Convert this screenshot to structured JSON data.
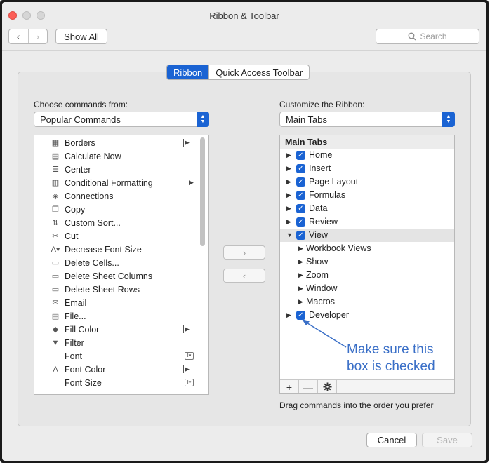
{
  "window": {
    "title": "Ribbon & Toolbar"
  },
  "toolbar": {
    "back_glyph": "‹",
    "forward_glyph": "›",
    "show_all_label": "Show All",
    "search_placeholder": "Search"
  },
  "tabs": [
    {
      "label": "Ribbon",
      "active": true
    },
    {
      "label": "Quick Access Toolbar",
      "active": false
    }
  ],
  "left": {
    "choose_label": "Choose commands from:",
    "selected": "Popular Commands",
    "commands": [
      {
        "label": "Borders",
        "icon": "borders-icon",
        "glyph": "▦",
        "arrow": "bar"
      },
      {
        "label": "Calculate Now",
        "icon": "calculate-icon",
        "glyph": "▤",
        "arrow": ""
      },
      {
        "label": "Center",
        "icon": "align-center-icon",
        "glyph": "☰",
        "arrow": ""
      },
      {
        "label": "Conditional Formatting",
        "icon": "conditional-formatting-icon",
        "glyph": "▥",
        "arrow": "plain"
      },
      {
        "label": "Connections",
        "icon": "connections-icon",
        "glyph": "◈",
        "arrow": ""
      },
      {
        "label": "Copy",
        "icon": "copy-icon",
        "glyph": "❐",
        "arrow": ""
      },
      {
        "label": "Custom Sort...",
        "icon": "sort-icon",
        "glyph": "⇅",
        "arrow": ""
      },
      {
        "label": "Cut",
        "icon": "scissors-icon",
        "glyph": "✂",
        "arrow": ""
      },
      {
        "label": "Decrease Font Size",
        "icon": "decrease-font-icon",
        "glyph": "A▾",
        "arrow": ""
      },
      {
        "label": "Delete Cells...",
        "icon": "delete-cells-icon",
        "glyph": "▭",
        "arrow": ""
      },
      {
        "label": "Delete Sheet Columns",
        "icon": "delete-columns-icon",
        "glyph": "▭",
        "arrow": ""
      },
      {
        "label": "Delete Sheet Rows",
        "icon": "delete-rows-icon",
        "glyph": "▭",
        "arrow": ""
      },
      {
        "label": "Email",
        "icon": "email-icon",
        "glyph": "✉",
        "arrow": ""
      },
      {
        "label": "File...",
        "icon": "file-icon",
        "glyph": "▤",
        "arrow": ""
      },
      {
        "label": "Fill Color",
        "icon": "fill-color-icon",
        "glyph": "◆",
        "arrow": "bar"
      },
      {
        "label": "Filter",
        "icon": "filter-icon",
        "glyph": "▼",
        "arrow": ""
      },
      {
        "label": "Font",
        "icon": "",
        "glyph": "",
        "arrow": "",
        "extra": "I▾"
      },
      {
        "label": "Font Color",
        "icon": "font-color-icon",
        "glyph": "A",
        "arrow": "bar"
      },
      {
        "label": "Font Size",
        "icon": "",
        "glyph": "",
        "arrow": "",
        "extra": "I▾"
      }
    ]
  },
  "move": {
    "add_glyph": "›",
    "remove_glyph": "‹"
  },
  "right": {
    "customize_label": "Customize the Ribbon:",
    "selected": "Main Tabs",
    "header": "Main Tabs",
    "items": [
      {
        "label": "Home",
        "level": 0,
        "checked": true,
        "expanded": false,
        "selected": false
      },
      {
        "label": "Insert",
        "level": 0,
        "checked": true,
        "expanded": false,
        "selected": false
      },
      {
        "label": "Page Layout",
        "level": 0,
        "checked": true,
        "expanded": false,
        "selected": false
      },
      {
        "label": "Formulas",
        "level": 0,
        "checked": true,
        "expanded": false,
        "selected": false
      },
      {
        "label": "Data",
        "level": 0,
        "checked": true,
        "expanded": false,
        "selected": false
      },
      {
        "label": "Review",
        "level": 0,
        "checked": true,
        "expanded": false,
        "selected": false
      },
      {
        "label": "View",
        "level": 0,
        "checked": true,
        "expanded": true,
        "selected": true
      },
      {
        "label": "Workbook Views",
        "level": 1,
        "checked": false,
        "expanded": false,
        "selected": false
      },
      {
        "label": "Show",
        "level": 1,
        "checked": false,
        "expanded": false,
        "selected": false
      },
      {
        "label": "Zoom",
        "level": 1,
        "checked": false,
        "expanded": false,
        "selected": false
      },
      {
        "label": "Window",
        "level": 1,
        "checked": false,
        "expanded": false,
        "selected": false
      },
      {
        "label": "Macros",
        "level": 1,
        "checked": false,
        "expanded": false,
        "selected": false
      },
      {
        "label": "Developer",
        "level": 0,
        "checked": true,
        "expanded": false,
        "selected": false
      }
    ],
    "footer_add": "+",
    "footer_remove": "—",
    "footer_gear": "✱",
    "hint": "Drag commands into the order you prefer"
  },
  "annotation": {
    "line1": "Make sure this",
    "line2": "box is checked"
  },
  "footer": {
    "cancel_label": "Cancel",
    "save_label": "Save"
  },
  "colors": {
    "accent": "#1a63d3",
    "annotation": "#3a6fc7"
  }
}
